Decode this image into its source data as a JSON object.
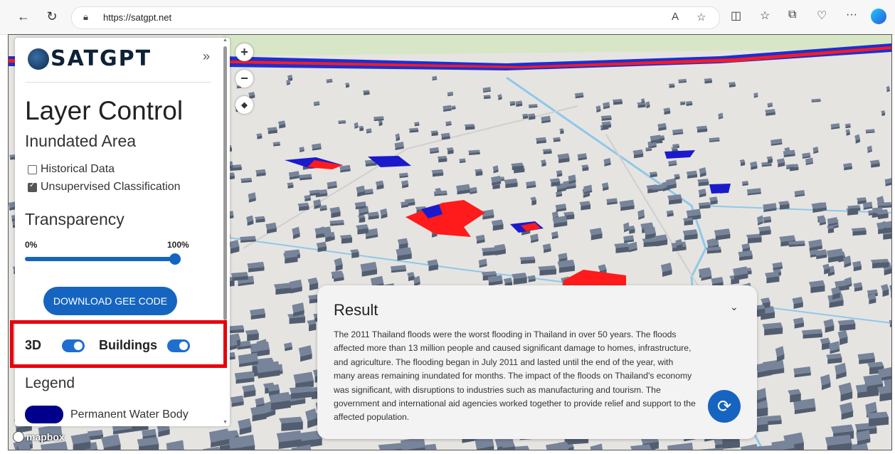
{
  "browser": {
    "url": "https://satgpt.net",
    "back_icon": "←",
    "reload_icon": "↻"
  },
  "panel": {
    "brand": "SATGPT",
    "collapse_icon": "»",
    "title": "Layer Control",
    "subtitle": "Inundated Area",
    "options": [
      {
        "label": "Historical Data",
        "checked": false
      },
      {
        "label": "Unsupervised Classification",
        "checked": true
      }
    ],
    "transparency_label": "Transparency",
    "slider_min": "0%",
    "slider_max": "100%",
    "slider_value": 1.0,
    "download_button": "DOWNLOAD GEE CODE",
    "toggle_3d_label": "3D",
    "toggle_buildings_label": "Buildings",
    "legend_title": "Legend",
    "legend_items": [
      {
        "label": "Permanent Water Body",
        "color": "#00008b"
      }
    ]
  },
  "map": {
    "zoom_in": "+",
    "zoom_out": "−",
    "compass": "◆",
    "attribution": "mapbox"
  },
  "result": {
    "title": "Result",
    "chevron": "⌄",
    "text": "The 2011 Thailand floods were the worst flooding in Thailand in over 50 years. The floods affected more than 13 million people and caused significant damage to homes, infrastructure, and agriculture. The flooding began in July 2011 and lasted until the end of the year, with many areas remaining inundated for months. The impact of the floods on Thailand's economy was significant, with disruptions to industries such as manufacturing and tourism. The government and international aid agencies worked together to provide relief and support to the affected population.",
    "refresh_icon": "⟳"
  },
  "colors": {
    "accent": "#1565c0",
    "flood_red": "#ff0000",
    "water_blue": "#0000cc",
    "highlight": "#e8000b",
    "building": "#6b7a8f"
  }
}
